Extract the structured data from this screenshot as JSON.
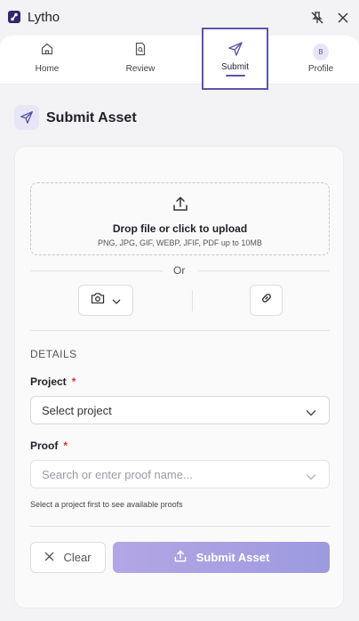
{
  "app": {
    "title": "Lytho"
  },
  "nav": {
    "tabs": [
      {
        "label": "Home",
        "icon": "home-icon"
      },
      {
        "label": "Review",
        "icon": "document-search-icon"
      },
      {
        "label": "Submit",
        "icon": "send-icon",
        "active": true
      },
      {
        "label": "Profile",
        "icon": "avatar",
        "avatar_initial": "B"
      }
    ]
  },
  "page": {
    "title": "Submit Asset"
  },
  "upload": {
    "title": "Drop file or click to upload",
    "subtitle": "PNG, JPG, GIF, WEBP, JFIF, PDF up to 10MB",
    "or_text": "Or"
  },
  "details": {
    "heading": "DETAILS",
    "project": {
      "label": "Project",
      "required_mark": "*",
      "placeholder": "Select project"
    },
    "proof": {
      "label": "Proof",
      "required_mark": "*",
      "placeholder": "Search or enter proof name...",
      "hint": "Select a project first to see available proofs"
    }
  },
  "actions": {
    "clear_label": "Clear",
    "submit_label": "Submit Asset"
  },
  "colors": {
    "accent": "#5a56a8",
    "submit_gradient_start": "#b3a6e4",
    "submit_gradient_end": "#9d9ae0",
    "required": "#d93030"
  }
}
